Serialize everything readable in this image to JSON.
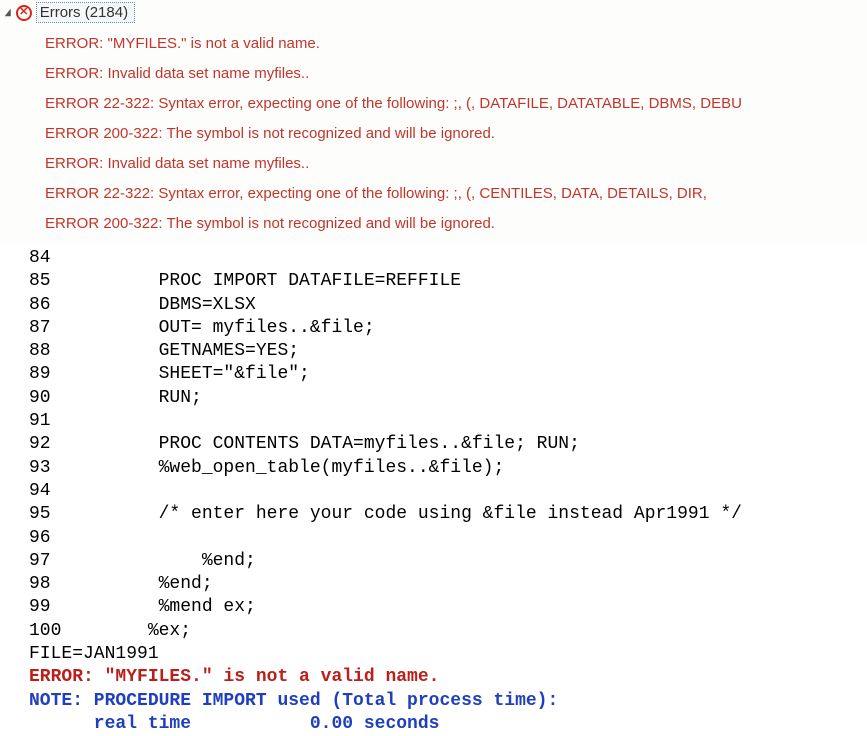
{
  "header": {
    "label": "Errors (2184)"
  },
  "errors": [
    "ERROR: \"MYFILES.\" is not a valid name.",
    "ERROR: Invalid data set name myfiles..",
    "ERROR 22-322: Syntax error, expecting one of the following: ;, (, DATAFILE, DATATABLE, DBMS, DEBU",
    "ERROR 200-322: The symbol is not recognized and will be ignored.",
    "ERROR: Invalid data set name myfiles..",
    "ERROR 22-322: Syntax error, expecting one of the following: ;, (, CENTILES, DATA, DETAILS, DIR,",
    "ERROR 200-322: The symbol is not recognized and will be ignored."
  ],
  "code": [
    {
      "n": "84",
      "t": ""
    },
    {
      "n": "85",
      "t": "         PROC IMPORT DATAFILE=REFFILE"
    },
    {
      "n": "86",
      "t": "         DBMS=XLSX"
    },
    {
      "n": "87",
      "t": "         OUT= myfiles..&file;"
    },
    {
      "n": "88",
      "t": "         GETNAMES=YES;"
    },
    {
      "n": "89",
      "t": "         SHEET=\"&file\";"
    },
    {
      "n": "90",
      "t": "         RUN;"
    },
    {
      "n": "91",
      "t": ""
    },
    {
      "n": "92",
      "t": "         PROC CONTENTS DATA=myfiles..&file; RUN;"
    },
    {
      "n": "93",
      "t": "         %web_open_table(myfiles..&file);"
    },
    {
      "n": "94",
      "t": ""
    },
    {
      "n": "95",
      "t": "         /* enter here your code using &file instead Apr1991 */"
    },
    {
      "n": "96",
      "t": ""
    },
    {
      "n": "97",
      "t": "             %end;"
    },
    {
      "n": "98",
      "t": "         %end;"
    },
    {
      "n": "99",
      "t": "         %mend ex;"
    },
    {
      "n": "100",
      "t": "        %ex;"
    }
  ],
  "log": {
    "file_line": "FILE=JAN1991",
    "error_line": "ERROR: \"MYFILES.\" is not a valid name.",
    "note_line": "NOTE: PROCEDURE IMPORT used (Total process time):",
    "timing_line": "      real time           0.00 seconds"
  }
}
